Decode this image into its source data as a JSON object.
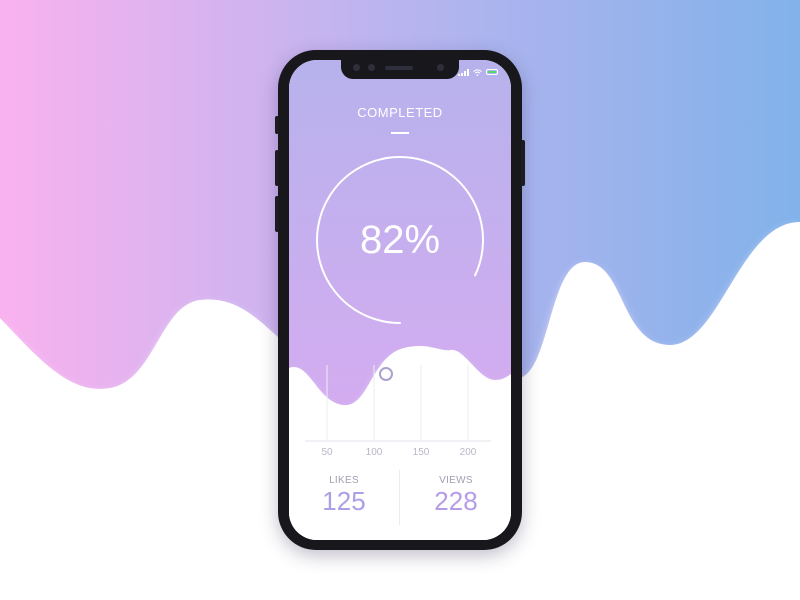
{
  "screen": {
    "title": "COMPLETED",
    "progress": {
      "percent_label": "82%",
      "value": 0.82
    },
    "axis_ticks": [
      "50",
      "100",
      "150",
      "200"
    ],
    "stats": [
      {
        "label": "LIKES",
        "value": "125",
        "color": "#a9a0e6"
      },
      {
        "label": "VIEWS",
        "value": "228",
        "color": "#b69be8"
      }
    ]
  },
  "colors": {
    "gradient_left": "#f9b2ef",
    "gradient_mid": "#b8b4ef",
    "gradient_right": "#82b2ea",
    "screen_top": "#b7b2ec",
    "screen_bottom": "#dfaaf2",
    "battery": "#4cd964"
  },
  "icons": [
    "signal-icon",
    "wifi-icon",
    "battery-icon"
  ]
}
